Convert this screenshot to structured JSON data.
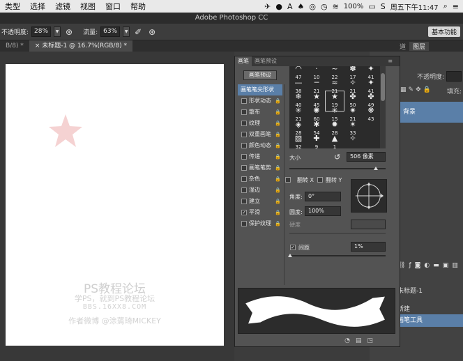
{
  "menubar": {
    "items": [
      "类型",
      "选择",
      "滤镜",
      "视图",
      "窗口",
      "帮助"
    ],
    "battery": "100%",
    "clock": "周五下午11:47"
  },
  "titlebar": {
    "title": "Adobe Photoshop CC"
  },
  "options_bar": {
    "opacity_label": "不透明度:",
    "opacity_value": "28%",
    "flow_label": "流量:",
    "flow_value": "63%",
    "workspace": "基本功能"
  },
  "doc_tabs": [
    {
      "label": "B/8) *"
    },
    {
      "label": "× 未标题-1 @ 16.7%(RGB/8) *"
    }
  ],
  "canvas": {
    "watermark": {
      "line1": "PS教程论坛",
      "line2": "学PS，就到PS教程论坛",
      "line3": "BBS.16XX8.COM",
      "line4": "作者微博 @涂蔫琦MICKEY"
    }
  },
  "dock": {
    "tabs": [
      "道",
      "图层"
    ],
    "opacity_label": "不透明度:",
    "fill_label": "填充:",
    "layer_name": "背景",
    "history_doc": "未标题-1",
    "history_new": "新建",
    "history_brush": "画笔工具"
  },
  "brush_panel": {
    "tabs": [
      "画笔",
      "画笔预设"
    ],
    "preset_button": "画笔预设",
    "options": [
      {
        "label": "画笔笔尖形状",
        "selected": true,
        "checked": false
      },
      {
        "label": "形状动态",
        "selected": false,
        "checked": false
      },
      {
        "label": "散布",
        "selected": false,
        "checked": false
      },
      {
        "label": "纹理",
        "selected": false,
        "checked": false
      },
      {
        "label": "双重画笔",
        "selected": false,
        "checked": false
      },
      {
        "label": "颜色动态",
        "selected": false,
        "checked": false
      },
      {
        "label": "传递",
        "selected": false,
        "checked": false
      },
      {
        "label": "画笔笔势",
        "selected": false,
        "checked": false
      },
      {
        "label": "杂色",
        "selected": false,
        "checked": false
      },
      {
        "label": "湿边",
        "selected": false,
        "checked": false
      },
      {
        "label": "建立",
        "selected": false,
        "checked": false
      },
      {
        "label": "平滑",
        "selected": false,
        "checked": true
      },
      {
        "label": "保护纹理",
        "selected": false,
        "checked": false
      }
    ],
    "tips": [
      {
        "glyph": "◠",
        "size": "47"
      },
      {
        "glyph": "·",
        "size": "10"
      },
      {
        "glyph": "~",
        "size": "22"
      },
      {
        "glyph": "✽",
        "size": "17"
      },
      {
        "glyph": "✦",
        "size": "41"
      },
      {
        "glyph": "—",
        "size": "38"
      },
      {
        "glyph": "─",
        "size": "21"
      },
      {
        "glyph": "≈",
        "size": "21"
      },
      {
        "glyph": "✧",
        "size": "21"
      },
      {
        "glyph": "✦",
        "size": "41"
      },
      {
        "glyph": "❄",
        "size": "40"
      },
      {
        "glyph": "★",
        "size": "45"
      },
      {
        "glyph": "★",
        "size": "19"
      },
      {
        "glyph": "✤",
        "size": "50"
      },
      {
        "glyph": "✤",
        "size": "49"
      },
      {
        "glyph": "✳",
        "size": "21"
      },
      {
        "glyph": "✺",
        "size": "60"
      },
      {
        "glyph": "✳",
        "size": "15"
      },
      {
        "glyph": "✷",
        "size": "21"
      },
      {
        "glyph": "❋",
        "size": "43"
      },
      {
        "glyph": "◈",
        "size": "28"
      },
      {
        "glyph": "✱",
        "size": "54"
      },
      {
        "glyph": "✹",
        "size": "28"
      },
      {
        "glyph": "✶",
        "size": "33"
      },
      {
        "glyph": "",
        "size": ""
      },
      {
        "glyph": "▨",
        "size": "32"
      },
      {
        "glyph": "✚",
        "size": "9"
      },
      {
        "glyph": "▲",
        "size": "1"
      },
      {
        "glyph": "✧",
        "size": ""
      },
      {
        "glyph": "",
        "size": ""
      }
    ],
    "size_label": "大小",
    "size_value": "506 像素",
    "flip_x": "翻转 X",
    "flip_y": "翻转 Y",
    "angle_label": "角度:",
    "angle_value": "0°",
    "roundness_label": "圆度:",
    "roundness_value": "100%",
    "hardness_label": "硬度",
    "spacing_label": "间距",
    "spacing_value": "1%",
    "spacing_checked": true
  }
}
